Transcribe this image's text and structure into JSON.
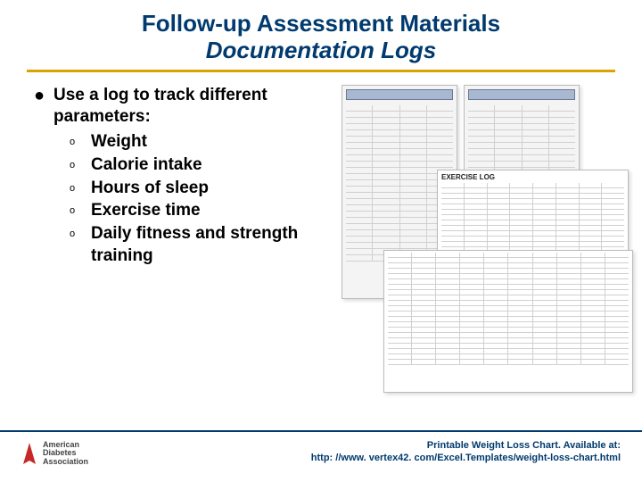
{
  "title": {
    "line1": "Follow-up Assessment Materials",
    "line2": "Documentation Logs"
  },
  "main_bullet": "Use a log to track different parameters:",
  "sub_items": [
    "Weight",
    "Calorie intake",
    "Hours of sleep",
    "Exercise time",
    "Daily fitness and strength training"
  ],
  "exercise_log_label": "EXERCISE LOG",
  "logo": {
    "line1": "American",
    "line2": "Diabetes",
    "line3": "Association"
  },
  "footer": {
    "line1": "Printable Weight Loss Chart. Available at:",
    "line2": "http: //www. vertex42. com/Excel.Templates/weight-loss-chart.html"
  }
}
